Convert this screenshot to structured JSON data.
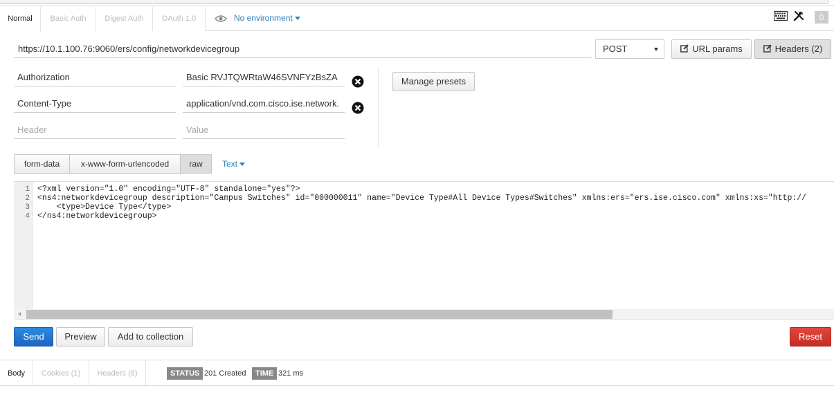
{
  "auth_tabs": [
    {
      "label": "Normal",
      "active": true
    },
    {
      "label": "Basic Auth",
      "active": false
    },
    {
      "label": "Digest Auth",
      "active": false
    },
    {
      "label": "OAuth 1.0",
      "active": false
    }
  ],
  "environment": {
    "label": "No environment",
    "icon": "eye-icon"
  },
  "toolbar_right": {
    "keyboard_icon": "keyboard-icon",
    "settings_icon": "wrench-icon",
    "count": "0"
  },
  "request": {
    "url": "https://10.1.100.76:9060/ers/config/networkdevicegroup",
    "method": "POST",
    "url_params_label": "URL params",
    "headers_label": "Headers (2)"
  },
  "headers": [
    {
      "key": "Authorization",
      "value": "Basic RVJTQWRtaW46SVNFYzBsZA"
    },
    {
      "key": "Content-Type",
      "value": "application/vnd.com.cisco.ise.network."
    }
  ],
  "header_placeholders": {
    "key": "Header",
    "value": "Value"
  },
  "manage_presets_label": "Manage presets",
  "body_tabs": [
    {
      "label": "form-data",
      "active": false
    },
    {
      "label": "x-www-form-urlencoded",
      "active": false
    },
    {
      "label": "raw",
      "active": true
    }
  ],
  "body_type": "Text",
  "editor": {
    "lines": [
      {
        "num": "1",
        "text": "<?xml version=\"1.0\" encoding=\"UTF-8\" standalone=\"yes\"?>"
      },
      {
        "num": "2",
        "text": "<ns4:networkdevicegroup description=\"Campus Switches\" id=\"000000011\" name=\"Device Type#All Device Types#Switches\" xmlns:ers=\"ers.ise.cisco.com\" xmlns:xs=\"http://"
      },
      {
        "num": "3",
        "text": "    <type>Device Type</type>"
      },
      {
        "num": "4",
        "text": "</ns4:networkdevicegroup>"
      }
    ]
  },
  "actions": {
    "send": "Send",
    "preview": "Preview",
    "add_to_collection": "Add to collection",
    "reset": "Reset"
  },
  "response_tabs": [
    {
      "label": "Body",
      "active": true
    },
    {
      "label": "Cookies (1)",
      "active": false
    },
    {
      "label": "Headers (8)",
      "active": false
    }
  ],
  "response_status": {
    "status_label": "STATUS",
    "status_value": "201 Created",
    "time_label": "TIME",
    "time_value": "321 ms"
  },
  "colors": {
    "link": "#2c7fb8",
    "send": "#1a66c2",
    "reset": "#c52c23",
    "badge": "#888888"
  }
}
